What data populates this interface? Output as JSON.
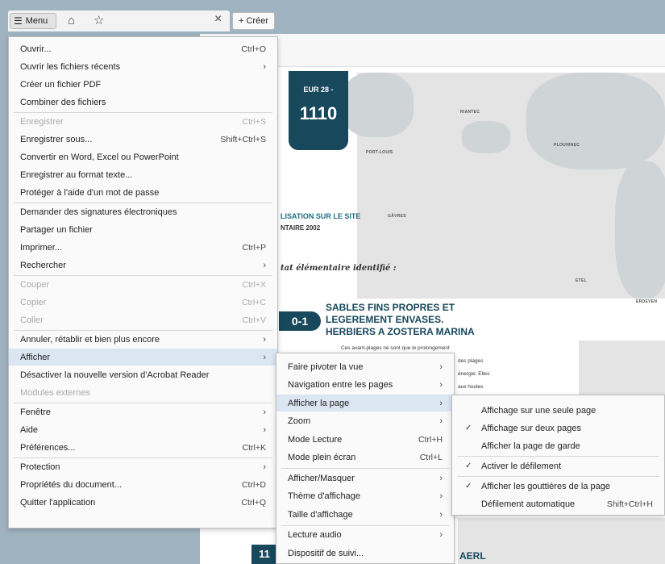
{
  "toolbar": {
    "menu_label": "Menu",
    "new_tab_label": "+ Créer",
    "close_glyph": "×"
  },
  "document": {
    "badge_top": "EUR 28 -",
    "badge_number": "1110",
    "bottom_badge": "11",
    "map_labels": [
      "RIANTEC",
      "PLOUHINEC",
      "PORT-LOUIS",
      "GÂVRES",
      "ETEL",
      "ERDEVEN"
    ],
    "localisation_line1": "LISATION SUR LE SITE",
    "localisation_line2": "NTAIRE 2002",
    "habitat_line": "tat élémentaire identifié :",
    "code_pill": "0-1",
    "heading1": "SABLES FINS PROPRES ET",
    "heading2": "LEGEREMENT ENVASES.",
    "heading3": "HERBIERS A ZOSTERA MARINA",
    "body_line1": "Ces avant-plages ne sont que le prolongement",
    "body_line2": "des plages",
    "body_line3": "énergie. Elles",
    "body_line4": "aux houles",
    "bottom_text": "AERL"
  },
  "main_menu": [
    {
      "label": "Ouvrir...",
      "shortcut": "Ctrl+O",
      "disabled": false
    },
    {
      "label": "Ouvrir les fichiers récents",
      "submenu": true,
      "disabled": false
    },
    {
      "label": "Créer un fichier PDF",
      "disabled": false
    },
    {
      "label": "Combiner des fichiers",
      "disabled": false
    },
    {
      "label": "Enregistrer",
      "shortcut": "Ctrl+S",
      "disabled": true
    },
    {
      "label": "Enregistrer sous...",
      "shortcut": "Shift+Ctrl+S",
      "disabled": false
    },
    {
      "label": "Convertir en Word, Excel ou PowerPoint",
      "disabled": false
    },
    {
      "label": "Enregistrer au format texte...",
      "disabled": false
    },
    {
      "label": "Protéger à l'aide d'un mot de passe",
      "disabled": false
    },
    {
      "label": "Demander des signatures électroniques",
      "disabled": false
    },
    {
      "label": "Partager un fichier",
      "disabled": false
    },
    {
      "label": "Imprimer...",
      "shortcut": "Ctrl+P",
      "disabled": false
    },
    {
      "label": "Rechercher",
      "submenu": true,
      "disabled": false
    },
    {
      "label": "Couper",
      "shortcut": "Ctrl+X",
      "disabled": true
    },
    {
      "label": "Copier",
      "shortcut": "Ctrl+C",
      "disabled": true
    },
    {
      "label": "Coller",
      "shortcut": "Ctrl+V",
      "disabled": true
    },
    {
      "label": "Annuler, rétablir et bien plus encore",
      "submenu": true,
      "disabled": false
    },
    {
      "label": "Afficher",
      "submenu": true,
      "disabled": false,
      "highlighted": true
    },
    {
      "label": "Désactiver la nouvelle version d'Acrobat Reader",
      "disabled": false
    },
    {
      "label": "Modules externes",
      "disabled": true
    },
    {
      "label": "Fenêtre",
      "submenu": true,
      "disabled": false
    },
    {
      "label": "Aide",
      "submenu": true,
      "disabled": false
    },
    {
      "label": "Préférences...",
      "shortcut": "Ctrl+K",
      "disabled": false
    },
    {
      "label": "Protection",
      "submenu": true,
      "disabled": false
    },
    {
      "label": "Propriétés du document...",
      "shortcut": "Ctrl+D",
      "disabled": false
    },
    {
      "label": "Quitter l'application",
      "shortcut": "Ctrl+Q",
      "disabled": false
    }
  ],
  "view_menu": [
    {
      "label": "Faire pivoter la vue",
      "submenu": true
    },
    {
      "label": "Navigation entre les pages",
      "submenu": true
    },
    {
      "label": "Afficher la page",
      "submenu": true,
      "highlighted": true
    },
    {
      "label": "Zoom",
      "submenu": true
    },
    {
      "label": "Mode Lecture",
      "shortcut": "Ctrl+H"
    },
    {
      "label": "Mode plein écran",
      "shortcut": "Ctrl+L"
    },
    {
      "label": "Afficher/Masquer",
      "submenu": true
    },
    {
      "label": "Thème d'affichage",
      "submenu": true
    },
    {
      "label": "Taille d'affichage",
      "submenu": true
    },
    {
      "label": "Lecture audio",
      "submenu": true
    },
    {
      "label": "Dispositif de suivi..."
    }
  ],
  "page_display_menu": [
    {
      "label": "Affichage sur une seule page",
      "checked": false
    },
    {
      "label": "Affichage sur deux pages",
      "checked": true
    },
    {
      "label": "Afficher la page de garde",
      "checked": false
    },
    {
      "label": "Activer le défilement",
      "checked": true
    },
    {
      "label": "Afficher les gouttières de la page",
      "checked": true
    },
    {
      "label": "Défilement automatique",
      "shortcut": "Shift+Ctrl+H",
      "checked": false
    }
  ],
  "glyphs": {
    "arrow": "›",
    "check": "✓"
  },
  "colors": {
    "highlight": "#dbe6f2",
    "accent": "#17485c",
    "background": "#9fb3c1"
  }
}
